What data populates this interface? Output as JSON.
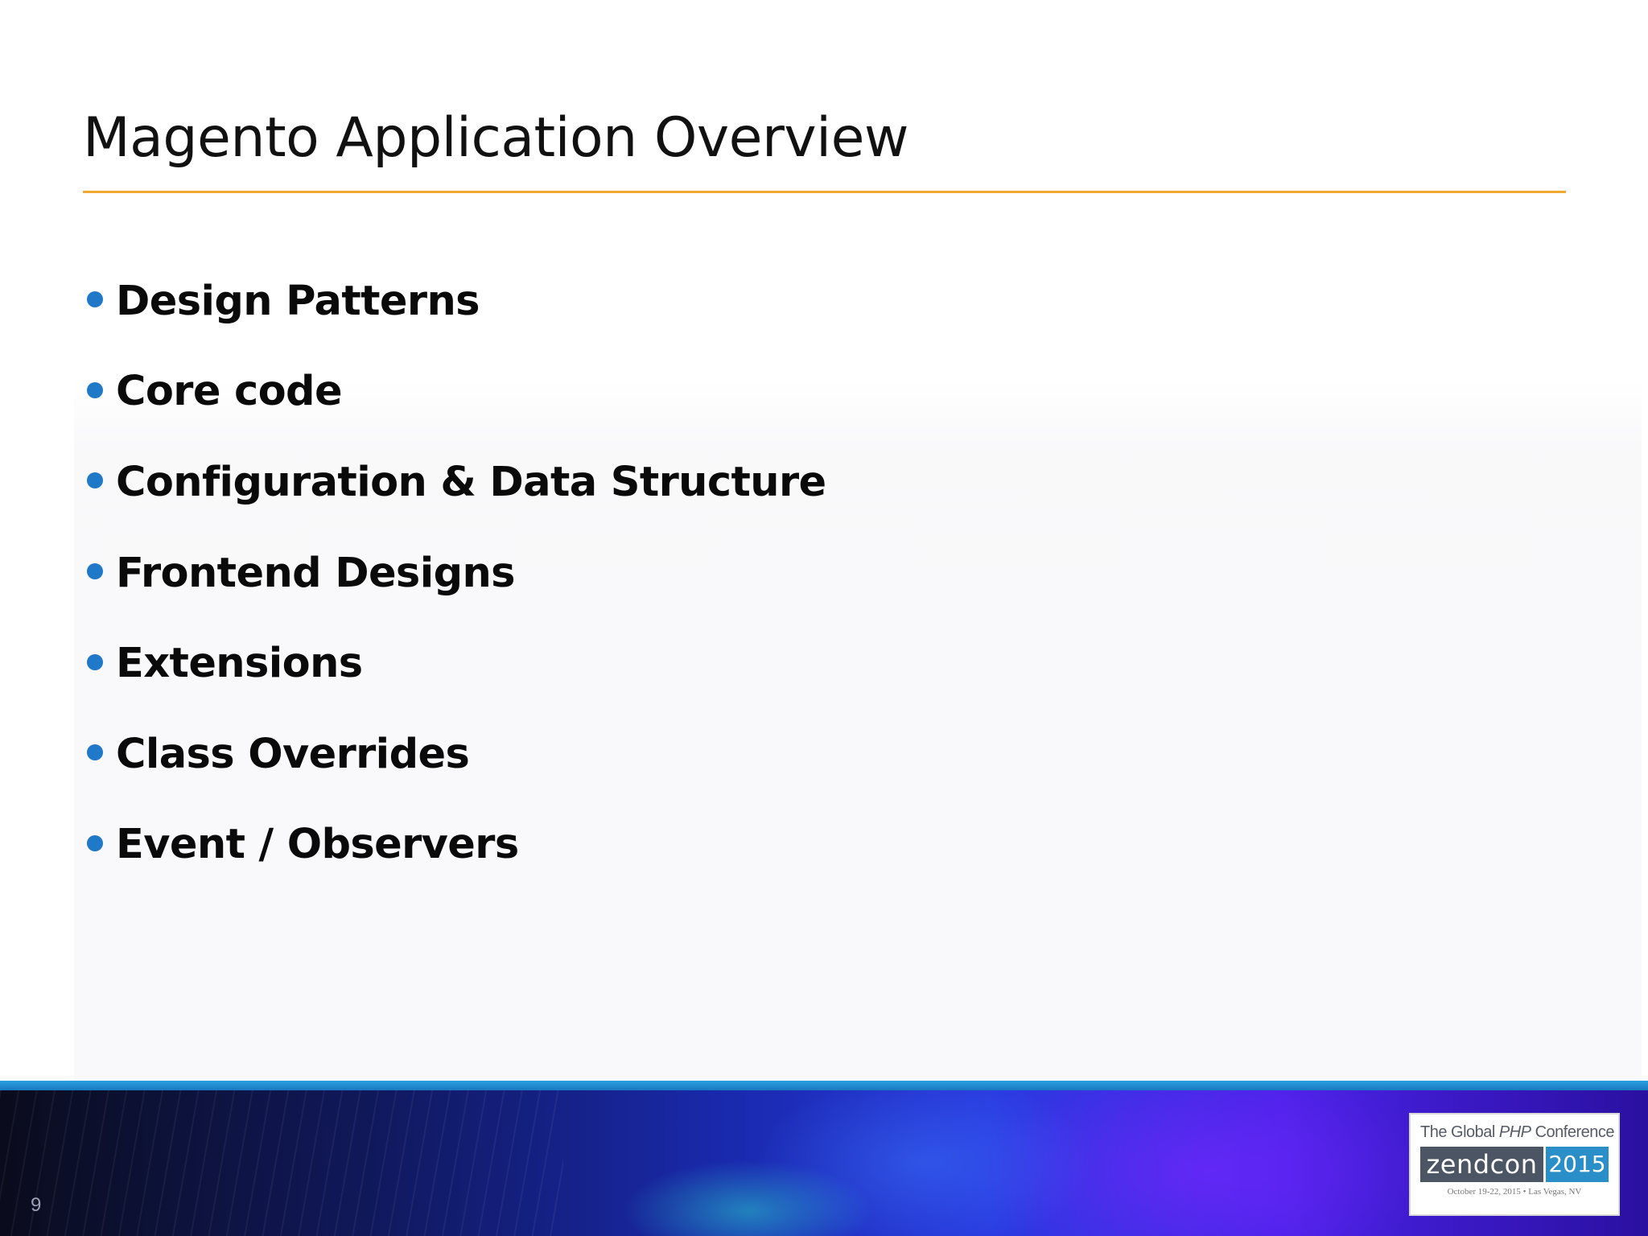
{
  "slide": {
    "title": "Magento Application Overview",
    "page_number": "9",
    "bullets": [
      {
        "text": "Design Patterns"
      },
      {
        "text": "Core code"
      },
      {
        "text": "Configuration & Data Structure"
      },
      {
        "text": "Frontend Designs"
      },
      {
        "text": "Extensions"
      },
      {
        "text": "Class Overrides"
      },
      {
        "text": "Event / Observers"
      }
    ]
  },
  "logo": {
    "tagline_prefix": "The Global ",
    "tagline_emphasis": "PHP",
    "tagline_suffix": " Conference",
    "brand": "zendcon",
    "year": "2015",
    "event_details": "October 19-22, 2015 • Las Vegas, NV"
  },
  "colors": {
    "title_rule": "#f0a830",
    "bullet_dot": "#1f78c8",
    "footer_accent": "#1a78c0"
  }
}
